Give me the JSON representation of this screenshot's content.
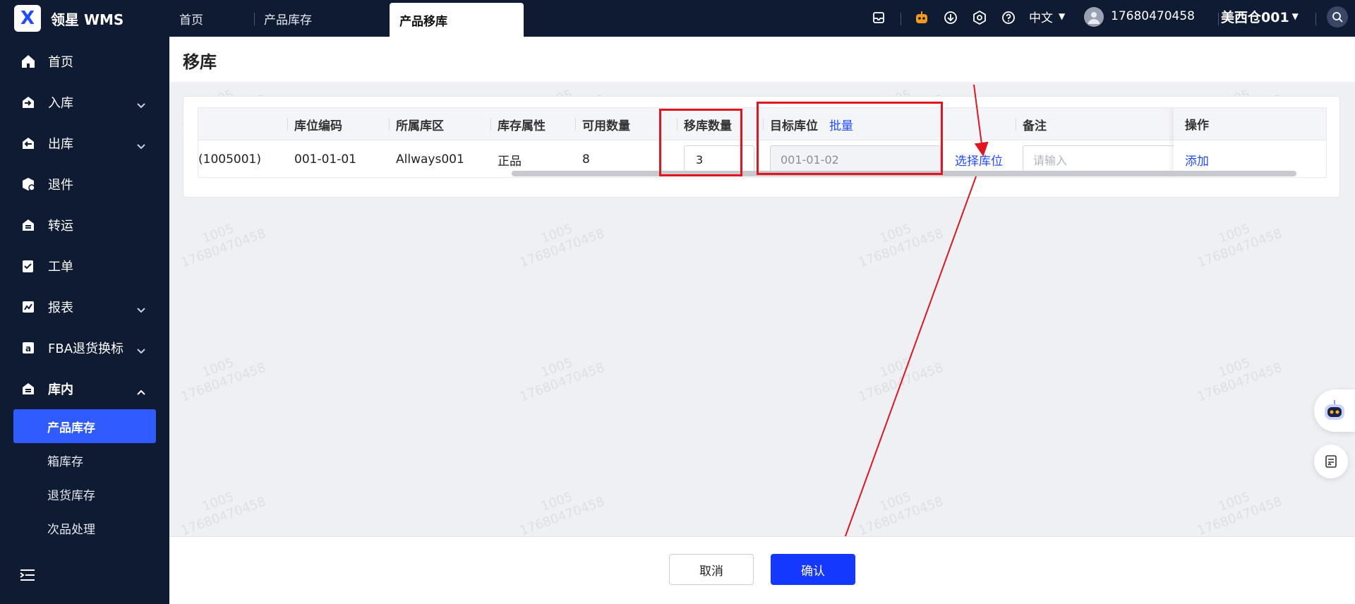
{
  "app": {
    "name": "领星 WMS",
    "logo_letter": "X"
  },
  "sidebar": {
    "items": [
      {
        "label": "首页",
        "icon": "home-icon"
      },
      {
        "label": "入库",
        "icon": "inbound-icon"
      },
      {
        "label": "出库",
        "icon": "outbound-icon"
      },
      {
        "label": "退件",
        "icon": "return-icon"
      },
      {
        "label": "转运",
        "icon": "transfer-icon"
      },
      {
        "label": "工单",
        "icon": "work-order-icon"
      },
      {
        "label": "报表",
        "icon": "report-icon"
      },
      {
        "label": "FBA退货换标",
        "icon": "amazon-icon"
      },
      {
        "label": "库内",
        "icon": "warehouse-icon"
      }
    ],
    "sub_items": [
      {
        "label": "产品库存",
        "active": true
      },
      {
        "label": "箱库存"
      },
      {
        "label": "退货库存"
      },
      {
        "label": "次品处理"
      }
    ]
  },
  "topbar": {
    "tabs": [
      {
        "label": "首页"
      },
      {
        "label": "产品库存"
      },
      {
        "label": "产品移库",
        "active": true
      }
    ],
    "language": "中文",
    "username": "17680470458",
    "warehouse": "美西仓001"
  },
  "page": {
    "title": "移库"
  },
  "table": {
    "headers": {
      "location_code": "库位编码",
      "zone": "所属库区",
      "stock_attr": "库存属性",
      "available_qty": "可用数量",
      "move_qty": "移库数量",
      "target_location": "目标库位",
      "batch": "批量",
      "remark": "备注",
      "operation": "操作"
    },
    "row": {
      "sku_suffix": "(1005001)",
      "location_code": "001-01-01",
      "zone": "Allways001",
      "stock_attr": "正品",
      "available_qty": "8",
      "move_qty": "3",
      "target_location": "001-01-02",
      "select_location": "选择库位",
      "remark_placeholder": "请输入",
      "operation": "添加"
    }
  },
  "watermark": {
    "line1": "1005",
    "line2": "17680470458"
  },
  "footer": {
    "cancel": "取消",
    "confirm": "确认"
  },
  "colors": {
    "primary": "#1538ff",
    "sidebar_bg": "#0f1a33",
    "annotation_red": "#e2141f"
  }
}
